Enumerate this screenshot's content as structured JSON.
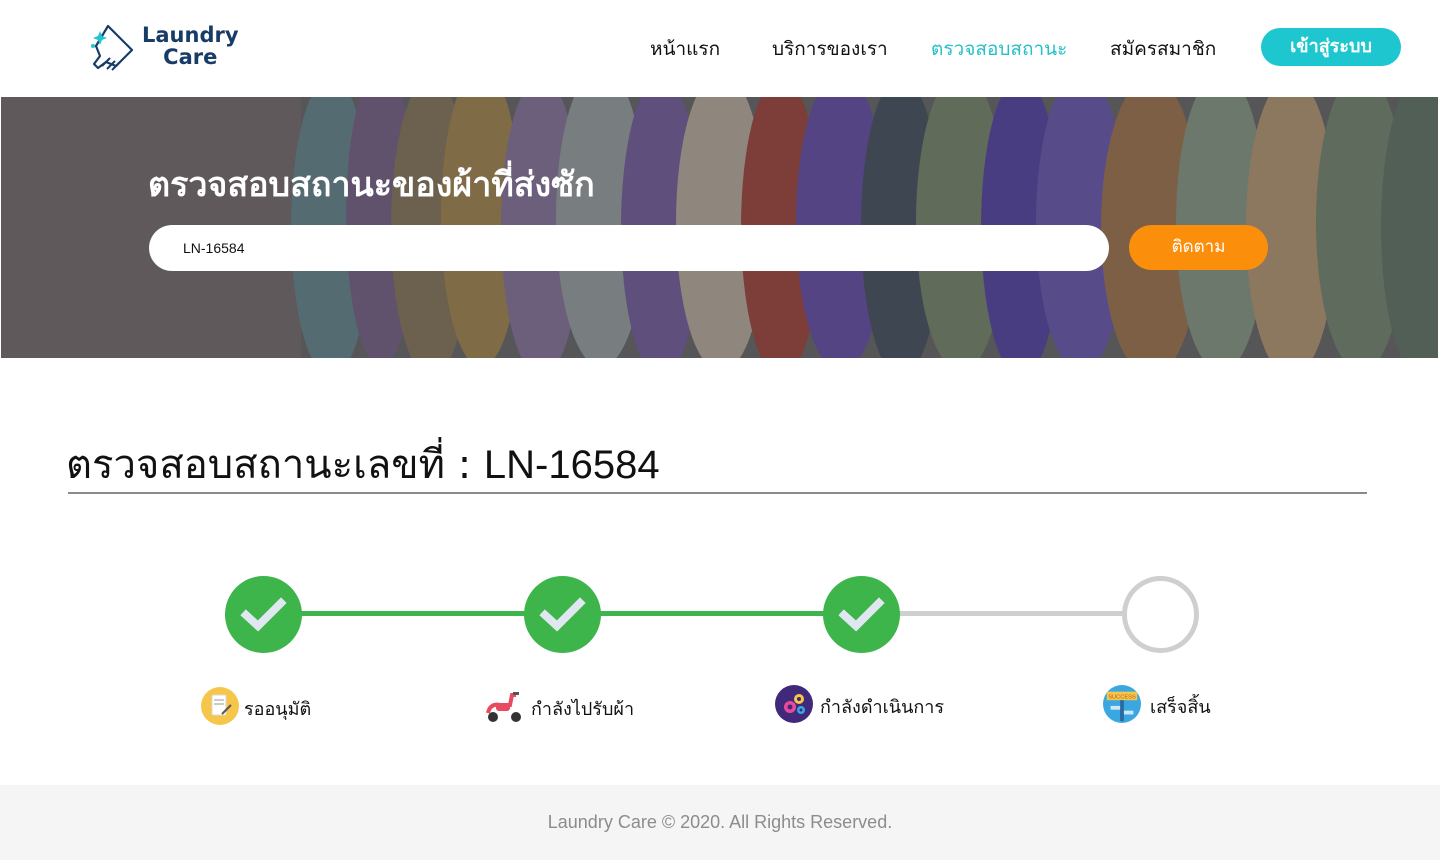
{
  "brand": {
    "line1": "Laundry",
    "line2": "Care"
  },
  "nav": [
    {
      "label": "หน้าแรก"
    },
    {
      "label": "บริการของเรา"
    },
    {
      "label": "ตรวจสอบสถานะ",
      "active": true
    },
    {
      "label": "สมัครสมาชิก"
    }
  ],
  "login_label": "เข้าสู่ระบบ",
  "hero": {
    "title": "ตรวจสอบสถานะของผ้าที่ส่งซัก",
    "search_value": "LN-16584",
    "track_label": "ติดตาม"
  },
  "status": {
    "title_prefix": "ตรวจสอบสถานะเลขที่ : ",
    "order_number": "LN-16584"
  },
  "steps": [
    {
      "label": "รออนุมัติ",
      "icon": "document-icon",
      "done": true
    },
    {
      "label": "กำลังไปรับผ้า",
      "icon": "scooter-icon",
      "done": true
    },
    {
      "label": "กำลังดำเนินการ",
      "icon": "gears-icon",
      "done": true
    },
    {
      "label": "เสร็จสิ้น",
      "icon": "success-sign-icon",
      "done": false
    }
  ],
  "footer": {
    "text": "Laundry Care © 2020. All Rights Reserved."
  },
  "colors": {
    "accent": "#1ec7cf",
    "brand": "#173c68",
    "orange": "#fb8f0c",
    "success": "#3db54a",
    "pending": "#cfcfcf"
  }
}
